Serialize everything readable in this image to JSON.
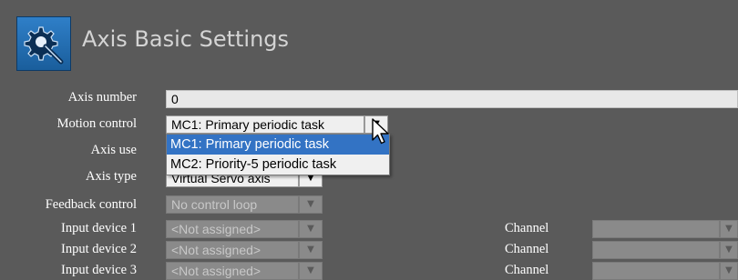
{
  "header": {
    "title": "Axis Basic Settings",
    "icon": "gear-magnifier-icon",
    "icon_color": "#2f7fc8"
  },
  "form": {
    "axis_number": {
      "label": "Axis number",
      "value": "0"
    },
    "motion_control": {
      "label": "Motion control",
      "value": "MC1: Primary periodic task",
      "options": [
        "MC1: Primary periodic task",
        "MC2: Priority-5 periodic task"
      ],
      "selected_index": 0
    },
    "axis_use": {
      "label": "Axis use"
    },
    "axis_type": {
      "label": "Axis type",
      "value": "Virtual Servo axis"
    },
    "feedback_control": {
      "label": "Feedback control",
      "value": "No control loop"
    },
    "input_device_1": {
      "label": "Input device 1",
      "value": "<Not assigned>"
    },
    "input_device_2": {
      "label": "Input device 2",
      "value": "<Not assigned>"
    },
    "input_device_3": {
      "label": "Input device 3",
      "value": "<Not assigned>"
    },
    "channel_label": "Channel"
  },
  "colors": {
    "background": "#5a5a5a",
    "selection": "#3373c4",
    "disabled_field": "#8a8a8a"
  }
}
